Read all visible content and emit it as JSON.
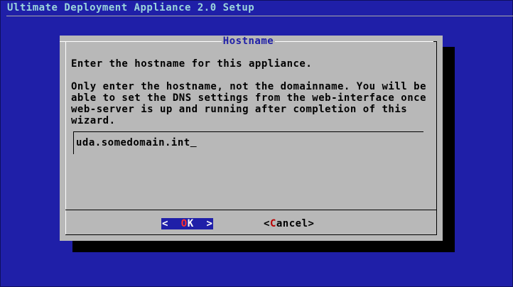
{
  "backtitle": "Ultimate Deployment Appliance 2.0 Setup",
  "dialog": {
    "title": "Hostname",
    "prompt": "Enter the hostname for this appliance.",
    "description": [
      "Only enter the hostname, not the domainname. You will be",
      "able to set the DNS settings from the web-interface once",
      "web-server is up and running after completion of this",
      "wizard."
    ],
    "input_value": "uda.somedomain.int",
    "buttons": {
      "ok": {
        "left": "<  ",
        "hotkey": "O",
        "rest": "K",
        "right": "  >"
      },
      "cancel": {
        "left": "<",
        "hotkey": "C",
        "rest": "ancel",
        "right": ">"
      }
    }
  },
  "colors": {
    "background": "#1f1fa8",
    "dialog": "#b8b8b8",
    "backtitle_text": "#9bd6dc",
    "title_text": "#1f1fa8",
    "hotkey_active": "#ff3030",
    "hotkey_inactive": "#b80000"
  }
}
